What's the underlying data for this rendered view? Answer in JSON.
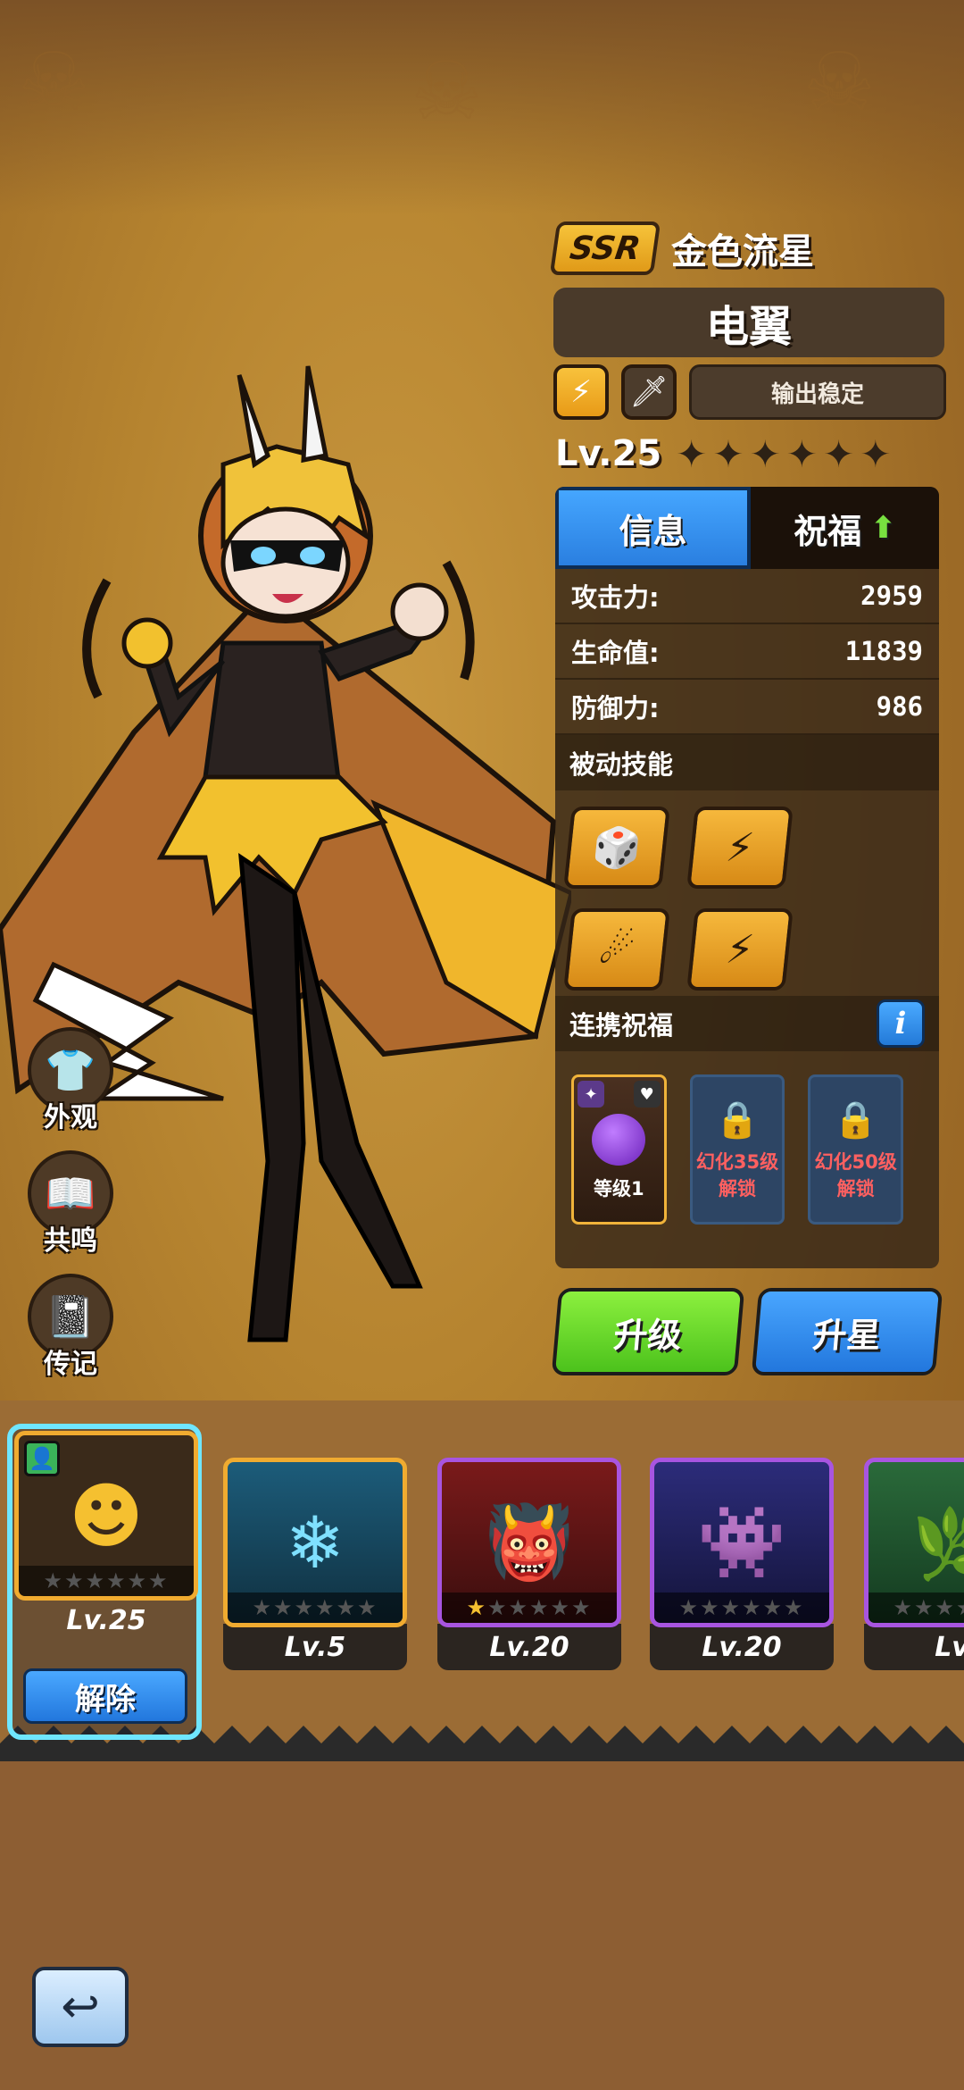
{
  "hero": {
    "rarity": "SSR",
    "title": "金色流星",
    "name": "电翼",
    "tag": "输出稳定",
    "level": "Lv.25",
    "stars_total": 6
  },
  "tabs": [
    {
      "label": "信息",
      "active": true
    },
    {
      "label": "祝福",
      "active": false
    }
  ],
  "stats": [
    {
      "label": "攻击力:",
      "value": "2959"
    },
    {
      "label": "生命值:",
      "value": "11839"
    },
    {
      "label": "防御力:",
      "value": "986"
    }
  ],
  "passive_skills_label": "被动技能",
  "bond_label": "连携祝福",
  "bonds": {
    "active_label": "等级1",
    "locked": [
      {
        "line1": "幻化35级",
        "line2": "解锁"
      },
      {
        "line1": "幻化50级",
        "line2": "解锁"
      }
    ]
  },
  "buttons": {
    "upgrade": "升级",
    "star_up": "升星",
    "unequip": "解除"
  },
  "side_menu": [
    {
      "label": "外观",
      "icon": "shirt-icon"
    },
    {
      "label": "共鸣",
      "icon": "book-icon"
    },
    {
      "label": "传记",
      "icon": "journal-icon"
    }
  ],
  "roster": [
    {
      "level": "Lv.25",
      "selected": true
    },
    {
      "level": "Lv.5",
      "selected": false
    },
    {
      "level": "Lv.20",
      "selected": false
    },
    {
      "level": "Lv.20",
      "selected": false
    },
    {
      "level": "Lv.",
      "selected": false
    }
  ]
}
